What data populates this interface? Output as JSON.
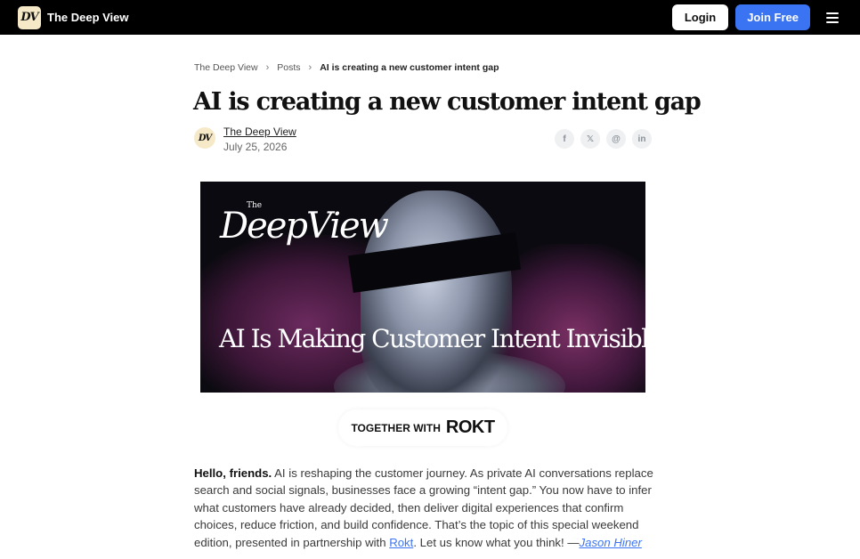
{
  "nav": {
    "logo_text": "DV",
    "brand": "The Deep View",
    "login_label": "Login",
    "join_label": "Join Free",
    "menu_icon": "hamburger-icon"
  },
  "breadcrumb": {
    "items": [
      "The Deep View",
      "Posts",
      "AI is creating a new customer intent gap"
    ]
  },
  "article": {
    "title": "AI is creating a new customer intent gap",
    "author": "The Deep View",
    "avatar_text": "DV",
    "date": "July 25, 2026",
    "share": [
      {
        "icon": "facebook-icon",
        "glyph": "f"
      },
      {
        "icon": "x-icon",
        "glyph": "𝕏"
      },
      {
        "icon": "threads-icon",
        "glyph": "@"
      },
      {
        "icon": "linkedin-icon",
        "glyph": "in"
      }
    ]
  },
  "hero": {
    "brand_the": "The",
    "brand_name": "DeepView",
    "caption": "AI Is Making Customer Intent Invisible"
  },
  "sponsor": {
    "together": "TOGETHER WITH",
    "partner": "ROKT"
  },
  "body": {
    "greeting": "Hello, friends.",
    "text1": " AI is reshaping the customer journey. As private AI conversations replace search and social signals, businesses face a growing “intent gap.” You now have to infer what customers have already decided, then deliver digital experiences that confirm choices, reduce friction, and build confidence. That’s the topic of this special weekend edition, presented in partnership with ",
    "link": "Rokt",
    "text2": ". Let us know what you think! —",
    "signature": "Jason Hiner"
  },
  "colors": {
    "accent": "#3b74f3",
    "topbar": "#000000",
    "badge": "#f6e9c8"
  }
}
